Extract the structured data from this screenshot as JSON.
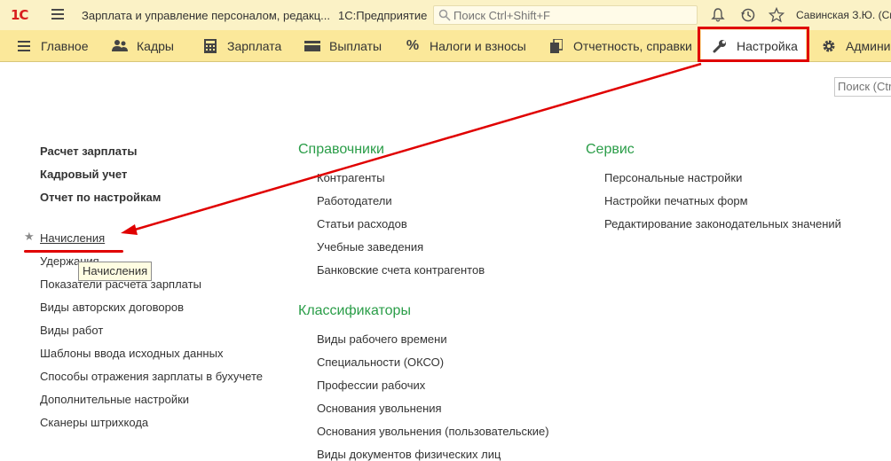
{
  "titlebar": {
    "logo": "1С",
    "app_title": "Зарплата и управление персоналом, редакц...",
    "platform": "1С:Предприятие",
    "search_placeholder": "Поиск Ctrl+Shift+F",
    "user": "Савинская З.Ю. (Сис"
  },
  "sections": {
    "main": "Главное",
    "hr": "Кадры",
    "salary": "Зарплата",
    "payments": "Выплаты",
    "taxes": "Налоги и взносы",
    "reports": "Отчетность, справки",
    "settings": "Настройка",
    "admin": "Админи"
  },
  "content": {
    "search_placeholder": "Поиск (Ctr",
    "col1": {
      "bold_items": [
        "Расчет зарплаты",
        "Кадровый учет",
        "Отчет по настройкам"
      ],
      "items": [
        "Начисления",
        "Удержания",
        "Показатели расчета зарплаты",
        "Виды авторских договоров",
        "Виды работ",
        "Шаблоны ввода исходных данных",
        "Способы отражения зарплаты в бухучете",
        "Дополнительные настройки",
        "Сканеры штрихкода"
      ]
    },
    "col2": {
      "group1": "Справочники",
      "group1_items": [
        "Контрагенты",
        "Работодатели",
        "Статьи расходов",
        "Учебные заведения",
        "Банковские счета контрагентов"
      ],
      "group2": "Классификаторы",
      "group2_items": [
        "Виды рабочего времени",
        "Специальности (ОКСО)",
        "Профессии рабочих",
        "Основания увольнения",
        "Основания увольнения (пользовательские)",
        "Виды документов физических лиц"
      ]
    },
    "col3": {
      "group": "Сервис",
      "items": [
        "Персональные настройки",
        "Настройки печатных форм",
        "Редактирование законодательных значений"
      ]
    },
    "tooltip": "Начисления"
  },
  "colors": {
    "accent_red": "#e00000",
    "group_green": "#2a9d48",
    "section_bar": "#fbe89a",
    "title_bar": "#fbf2c6"
  },
  "icons": [
    "menu-icon",
    "search-icon",
    "bell-icon",
    "history-icon",
    "star-icon",
    "hamburger-icon",
    "people-icon",
    "calculator-icon",
    "wallet-icon",
    "percent-icon",
    "copy-icon",
    "wrench-icon",
    "gear-icon"
  ]
}
